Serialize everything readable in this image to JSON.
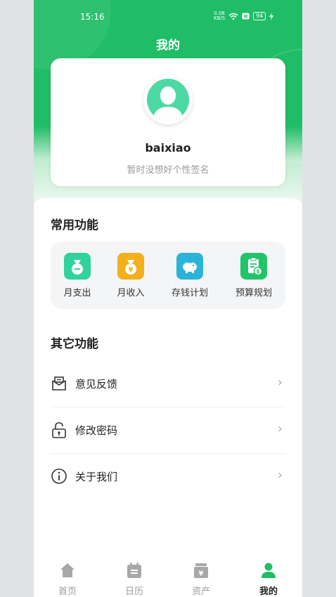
{
  "status_bar": {
    "time": "15:16",
    "network_speed_top": "0.08",
    "network_speed_bottom": "KB/S",
    "battery": "94"
  },
  "header": {
    "title": "我的"
  },
  "profile": {
    "username": "baixiao",
    "signature": "暂时没想好个性签名"
  },
  "common_functions": {
    "title": "常用功能",
    "items": [
      {
        "label": "月支出",
        "icon": "money-bag-icon",
        "color": "#2fd39b"
      },
      {
        "label": "月收入",
        "icon": "yen-bag-icon",
        "color": "#f2b01d"
      },
      {
        "label": "存钱计划",
        "icon": "piggy-bank-icon",
        "color": "#2bb3d9"
      },
      {
        "label": "预算规划",
        "icon": "budget-clipboard-icon",
        "color": "#22c46a"
      }
    ]
  },
  "other_functions": {
    "title": "其它功能",
    "items": [
      {
        "label": "意见反馈",
        "icon": "feedback-envelope-icon"
      },
      {
        "label": "修改密码",
        "icon": "lock-icon"
      },
      {
        "label": "关于我们",
        "icon": "info-icon"
      }
    ]
  },
  "tabbar": {
    "items": [
      {
        "label": "首页",
        "icon": "home-icon",
        "active": false
      },
      {
        "label": "日历",
        "icon": "calendar-icon",
        "active": false
      },
      {
        "label": "资产",
        "icon": "assets-icon",
        "active": false
      },
      {
        "label": "我的",
        "icon": "user-icon",
        "active": true
      }
    ]
  },
  "colors": {
    "brand_green": "#1fbd66",
    "avatar_green": "#4cd9a3",
    "active_tab": "#1fbd66",
    "inactive_tab": "#a8a8a8"
  }
}
